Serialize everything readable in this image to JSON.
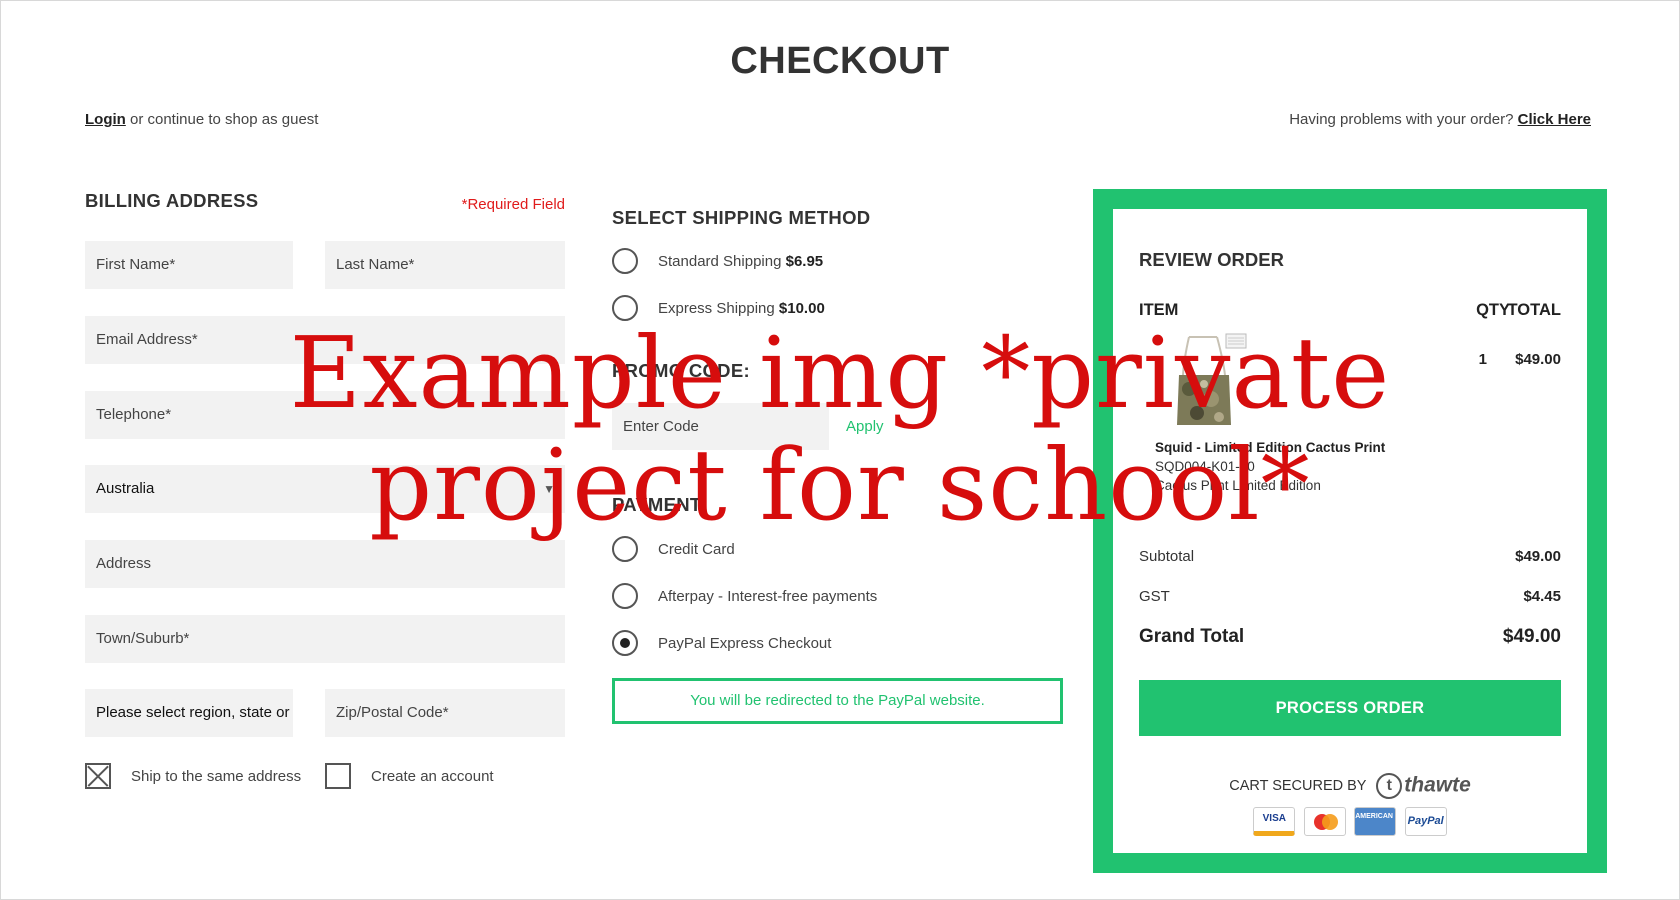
{
  "page": {
    "title": "CHECKOUT"
  },
  "topbar": {
    "login_link": "Login",
    "guest_text": " or continue to shop as guest",
    "problems_text": "Having problems with your order? ",
    "click_here": "Click Here"
  },
  "billing": {
    "title": "BILLING ADDRESS",
    "required_note": "*Required Field",
    "first_name_placeholder": "First Name*",
    "last_name_placeholder": "Last Name*",
    "email_placeholder": "Email Address*",
    "telephone_placeholder": "Telephone*",
    "country_value": "Australia",
    "address_placeholder": "Address",
    "town_placeholder": "Town/Suburb*",
    "region_value": "Please select region, state or province",
    "zip_placeholder": "Zip/Postal Code*",
    "ship_same_label": "Ship to the same address",
    "ship_same_checked": true,
    "create_account_label": "Create an account",
    "create_account_checked": false
  },
  "shipping": {
    "title": "SELECT SHIPPING METHOD",
    "options": [
      {
        "label": "Standard Shipping ",
        "price": "$6.95",
        "selected": false
      },
      {
        "label": "Express Shipping ",
        "price": "$10.00",
        "selected": false
      }
    ]
  },
  "promo": {
    "title": "PROMO CODE:",
    "placeholder": "Enter Code",
    "apply_label": "Apply"
  },
  "payment": {
    "title": "PAYMENT",
    "options": [
      {
        "label": "Credit Card",
        "selected": false
      },
      {
        "label": "Afterpay - Interest-free payments",
        "selected": false
      },
      {
        "label": "PayPal Express Checkout",
        "selected": true
      }
    ],
    "redirect_note": "You will be redirected to the PayPal website."
  },
  "review": {
    "title": "REVIEW ORDER",
    "col_item": "ITEM",
    "col_qty": "QTY",
    "col_total": "TOTAL",
    "item": {
      "name": "Squid - Limited Edition Cactus Print",
      "sku": "SQD004-K01-40",
      "variant": "Cactus Print Limited Edition",
      "qty": "1",
      "total": "$49.00"
    },
    "subtotal_label": "Subtotal",
    "subtotal_value": "$49.00",
    "gst_label": "GST",
    "gst_value": "$4.45",
    "grand_label": "Grand Total",
    "grand_value": "$49.00",
    "process_label": "PROCESS ORDER",
    "secured_label": "CART SECURED BY",
    "secured_brand": "thawte",
    "cards": [
      "VISA",
      "MasterCard",
      "AMERICAN EXPRESS",
      "PayPal"
    ]
  },
  "watermark": {
    "line1": "Example img *private",
    "line2": "project for school*"
  },
  "colors": {
    "accent": "#21c270",
    "required": "#e01b1b",
    "watermark": "#d60d0d",
    "field_bg": "#f2f2f2"
  },
  "icons": [
    "checkbox-checked-icon",
    "checkbox-empty-icon",
    "radio-empty-icon",
    "radio-selected-icon",
    "chevron-down-icon",
    "thawte-logo-icon",
    "visa-card-icon",
    "mastercard-icon",
    "amex-card-icon",
    "paypal-card-icon",
    "product-thumbnail"
  ]
}
